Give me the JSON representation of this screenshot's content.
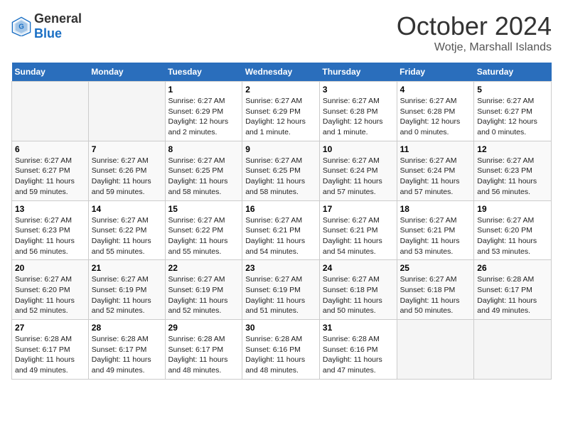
{
  "logo": {
    "general": "General",
    "blue": "Blue"
  },
  "title": "October 2024",
  "subtitle": "Wotje, Marshall Islands",
  "days_header": [
    "Sunday",
    "Monday",
    "Tuesday",
    "Wednesday",
    "Thursday",
    "Friday",
    "Saturday"
  ],
  "weeks": [
    [
      {
        "day": "",
        "info": ""
      },
      {
        "day": "",
        "info": ""
      },
      {
        "day": "1",
        "info": "Sunrise: 6:27 AM\nSunset: 6:29 PM\nDaylight: 12 hours\nand 2 minutes."
      },
      {
        "day": "2",
        "info": "Sunrise: 6:27 AM\nSunset: 6:29 PM\nDaylight: 12 hours\nand 1 minute."
      },
      {
        "day": "3",
        "info": "Sunrise: 6:27 AM\nSunset: 6:28 PM\nDaylight: 12 hours\nand 1 minute."
      },
      {
        "day": "4",
        "info": "Sunrise: 6:27 AM\nSunset: 6:28 PM\nDaylight: 12 hours\nand 0 minutes."
      },
      {
        "day": "5",
        "info": "Sunrise: 6:27 AM\nSunset: 6:27 PM\nDaylight: 12 hours\nand 0 minutes."
      }
    ],
    [
      {
        "day": "6",
        "info": "Sunrise: 6:27 AM\nSunset: 6:27 PM\nDaylight: 11 hours\nand 59 minutes."
      },
      {
        "day": "7",
        "info": "Sunrise: 6:27 AM\nSunset: 6:26 PM\nDaylight: 11 hours\nand 59 minutes."
      },
      {
        "day": "8",
        "info": "Sunrise: 6:27 AM\nSunset: 6:25 PM\nDaylight: 11 hours\nand 58 minutes."
      },
      {
        "day": "9",
        "info": "Sunrise: 6:27 AM\nSunset: 6:25 PM\nDaylight: 11 hours\nand 58 minutes."
      },
      {
        "day": "10",
        "info": "Sunrise: 6:27 AM\nSunset: 6:24 PM\nDaylight: 11 hours\nand 57 minutes."
      },
      {
        "day": "11",
        "info": "Sunrise: 6:27 AM\nSunset: 6:24 PM\nDaylight: 11 hours\nand 57 minutes."
      },
      {
        "day": "12",
        "info": "Sunrise: 6:27 AM\nSunset: 6:23 PM\nDaylight: 11 hours\nand 56 minutes."
      }
    ],
    [
      {
        "day": "13",
        "info": "Sunrise: 6:27 AM\nSunset: 6:23 PM\nDaylight: 11 hours\nand 56 minutes."
      },
      {
        "day": "14",
        "info": "Sunrise: 6:27 AM\nSunset: 6:22 PM\nDaylight: 11 hours\nand 55 minutes."
      },
      {
        "day": "15",
        "info": "Sunrise: 6:27 AM\nSunset: 6:22 PM\nDaylight: 11 hours\nand 55 minutes."
      },
      {
        "day": "16",
        "info": "Sunrise: 6:27 AM\nSunset: 6:21 PM\nDaylight: 11 hours\nand 54 minutes."
      },
      {
        "day": "17",
        "info": "Sunrise: 6:27 AM\nSunset: 6:21 PM\nDaylight: 11 hours\nand 54 minutes."
      },
      {
        "day": "18",
        "info": "Sunrise: 6:27 AM\nSunset: 6:21 PM\nDaylight: 11 hours\nand 53 minutes."
      },
      {
        "day": "19",
        "info": "Sunrise: 6:27 AM\nSunset: 6:20 PM\nDaylight: 11 hours\nand 53 minutes."
      }
    ],
    [
      {
        "day": "20",
        "info": "Sunrise: 6:27 AM\nSunset: 6:20 PM\nDaylight: 11 hours\nand 52 minutes."
      },
      {
        "day": "21",
        "info": "Sunrise: 6:27 AM\nSunset: 6:19 PM\nDaylight: 11 hours\nand 52 minutes."
      },
      {
        "day": "22",
        "info": "Sunrise: 6:27 AM\nSunset: 6:19 PM\nDaylight: 11 hours\nand 52 minutes."
      },
      {
        "day": "23",
        "info": "Sunrise: 6:27 AM\nSunset: 6:19 PM\nDaylight: 11 hours\nand 51 minutes."
      },
      {
        "day": "24",
        "info": "Sunrise: 6:27 AM\nSunset: 6:18 PM\nDaylight: 11 hours\nand 50 minutes."
      },
      {
        "day": "25",
        "info": "Sunrise: 6:27 AM\nSunset: 6:18 PM\nDaylight: 11 hours\nand 50 minutes."
      },
      {
        "day": "26",
        "info": "Sunrise: 6:28 AM\nSunset: 6:17 PM\nDaylight: 11 hours\nand 49 minutes."
      }
    ],
    [
      {
        "day": "27",
        "info": "Sunrise: 6:28 AM\nSunset: 6:17 PM\nDaylight: 11 hours\nand 49 minutes."
      },
      {
        "day": "28",
        "info": "Sunrise: 6:28 AM\nSunset: 6:17 PM\nDaylight: 11 hours\nand 49 minutes."
      },
      {
        "day": "29",
        "info": "Sunrise: 6:28 AM\nSunset: 6:17 PM\nDaylight: 11 hours\nand 48 minutes."
      },
      {
        "day": "30",
        "info": "Sunrise: 6:28 AM\nSunset: 6:16 PM\nDaylight: 11 hours\nand 48 minutes."
      },
      {
        "day": "31",
        "info": "Sunrise: 6:28 AM\nSunset: 6:16 PM\nDaylight: 11 hours\nand 47 minutes."
      },
      {
        "day": "",
        "info": ""
      },
      {
        "day": "",
        "info": ""
      }
    ]
  ]
}
